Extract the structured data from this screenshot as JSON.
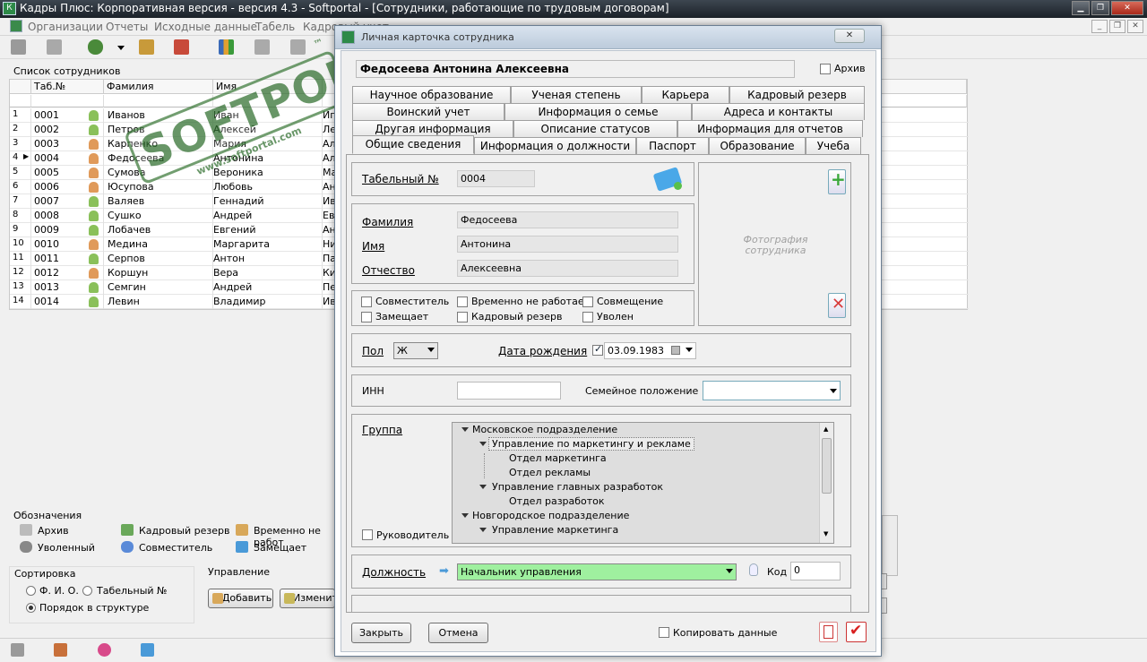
{
  "app": {
    "title": "Кадры Плюс: Корпоративная версия - версия 4.3 - Softportal - [Сотрудники, работающие по трудовым договорам]",
    "menu": [
      "Организации",
      "Отчеты",
      "Исходные данные",
      "Табель",
      "Кадровый учет"
    ]
  },
  "list": {
    "label": "Список сотрудников",
    "columns": [
      "Таб.№",
      "Фамилия",
      "Имя"
    ],
    "rows": [
      {
        "n": "1",
        "tab": "0001",
        "last": "Иванов",
        "first": "Иван",
        "extra": "Иг",
        "gender": "m"
      },
      {
        "n": "2",
        "tab": "0002",
        "last": "Петров",
        "first": "Алексей",
        "extra": "Ле",
        "gender": "m"
      },
      {
        "n": "3",
        "tab": "0003",
        "last": "Карпенко",
        "first": "Мария",
        "extra": "Ал",
        "gender": "f"
      },
      {
        "n": "4",
        "tab": "0004",
        "last": "Федосеева",
        "first": "Антонина",
        "extra": "Ал",
        "gender": "f"
      },
      {
        "n": "5",
        "tab": "0005",
        "last": "Сумова",
        "first": "Вероника",
        "extra": "Ма",
        "gender": "f"
      },
      {
        "n": "6",
        "tab": "0006",
        "last": "Юсупова",
        "first": "Любовь",
        "extra": "Ан",
        "gender": "f"
      },
      {
        "n": "7",
        "tab": "0007",
        "last": "Валяев",
        "first": "Геннадий",
        "extra": "Ив",
        "gender": "m"
      },
      {
        "n": "8",
        "tab": "0008",
        "last": "Сушко",
        "first": "Андрей",
        "extra": "Ев",
        "gender": "m"
      },
      {
        "n": "9",
        "tab": "0009",
        "last": "Лобачев",
        "first": "Евгений",
        "extra": "Ан",
        "gender": "m"
      },
      {
        "n": "10",
        "tab": "0010",
        "last": "Медина",
        "first": "Маргарита",
        "extra": "Ни",
        "gender": "f"
      },
      {
        "n": "11",
        "tab": "0011",
        "last": "Серпов",
        "first": "Антон",
        "extra": "Па",
        "gender": "m"
      },
      {
        "n": "12",
        "tab": "0012",
        "last": "Коршун",
        "first": "Вера",
        "extra": "Ки",
        "gender": "f"
      },
      {
        "n": "13",
        "tab": "0013",
        "last": "Семгин",
        "first": "Андрей",
        "extra": "Пе",
        "gender": "m"
      },
      {
        "n": "14",
        "tab": "0014",
        "last": "Левин",
        "first": "Владимир",
        "extra": "Ив",
        "gender": "m"
      }
    ]
  },
  "legend": {
    "title": "Обозначения",
    "archive": "Архив",
    "dismissed": "Уволенный",
    "reserve": "Кадровый резерв",
    "combiner": "Совместитель",
    "temp": "Временно не работ",
    "replaces": "Замещает"
  },
  "sort": {
    "title": "Сортировка",
    "fio": "Ф. И. О.",
    "tabno": "Табельный №",
    "order": "Порядок в структуре"
  },
  "manage": {
    "title": "Управление",
    "add": "Добавить",
    "edit": "Изменит"
  },
  "watermark": {
    "brand": "SOFTPORTAL",
    "tm": "™",
    "url": "www.softportal.com"
  },
  "dialog": {
    "title": "Личная карточка сотрудника",
    "close_glyph": "✕",
    "employee_name": "Федосеева Антонина Алексеевна",
    "archive_label": "Архив",
    "tabs_row1": [
      "Научное образование",
      "Ученая степень",
      "Карьера",
      "Кадровый резерв"
    ],
    "tabs_row2": [
      "Воинский учет",
      "Информация о семье",
      "Адреса и контакты"
    ],
    "tabs_row3": [
      "Другая информация",
      "Описание статусов",
      "Информация для отчетов"
    ],
    "tabs_row4": [
      "Общие сведения",
      "Информация о должности",
      "Паспорт",
      "Образование",
      "Учеба"
    ],
    "tabno_label": "Табельный №",
    "tabno_value": "0004",
    "last_label": "Фамилия",
    "last_value": "Федосеева",
    "first_label": "Имя",
    "first_value": "Антонина",
    "middle_label": "Отчество",
    "middle_value": "Алексеевна",
    "photo_text": "Фотография сотрудника",
    "flags": {
      "combiner": "Совместитель",
      "temp_off": "Временно не работает",
      "combining": "Совмещение",
      "replaces": "Замещает",
      "reserve": "Кадровый резерв",
      "dismissed": "Уволен"
    },
    "sex_label": "Пол",
    "sex_value": "Ж",
    "birth_label": "Дата рождения",
    "birth_value": "03.09.1983",
    "inn_label": "ИНН",
    "inn_value": "",
    "family_label": "Семейное положение",
    "family_value": "",
    "group_label": "Группа",
    "tree": [
      "Московское подразделение",
      "Управление по маркетингу и рекламе",
      "Отдел маркетинга",
      "Отдел рекламы",
      "Управление главных разработок",
      "Отдел разработок",
      "Новгородское подразделение",
      "Управление маркетинга"
    ],
    "head_label": "Руководитель",
    "position_label": "Должность",
    "position_value": "Начальник управления",
    "code_label": "Код",
    "code_value": "0",
    "btn_close": "Закрыть",
    "btn_cancel": "Отмена",
    "copy_label": "Копировать данные"
  },
  "colors": {
    "titlebar": "#1f262d",
    "position_highlight": "#9ff09f",
    "watermark": "#2f6e2e"
  }
}
